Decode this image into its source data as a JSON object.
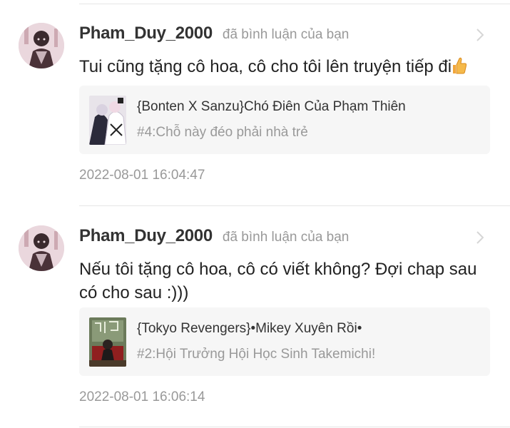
{
  "notifications": [
    {
      "username": "Pham_Duy_2000",
      "action": "đã bình luận của bạn",
      "comment": "Tui cũng tặng cô hoa, cô cho tôi lên truyện tiếp đi",
      "emoji_icon": "thumbs-up-icon",
      "story_title": "{Bonten X Sanzu}Chó Điên Của Phạm Thiên",
      "chapter": "#4:Chỗ này đéo phải nhà trẻ",
      "timestamp": "2022-08-01 16:04:47"
    },
    {
      "username": "Pham_Duy_2000",
      "action": "đã bình luận của bạn",
      "comment": "Nếu tôi tặng cô hoa, cô có viết không? Đợi chap sau có cho sau :)))",
      "story_title": "{Tokyo Revengers}•Mikey Xuyên Rồi•",
      "chapter": "#2:Hội Trưởng Hội Học Sinh Takemichi!",
      "timestamp": "2022-08-01 16:06:14"
    }
  ],
  "colors": {
    "username": "#333333",
    "muted": "#999999",
    "card_bg": "#f6f6f6",
    "divider": "#e6e6e6"
  }
}
